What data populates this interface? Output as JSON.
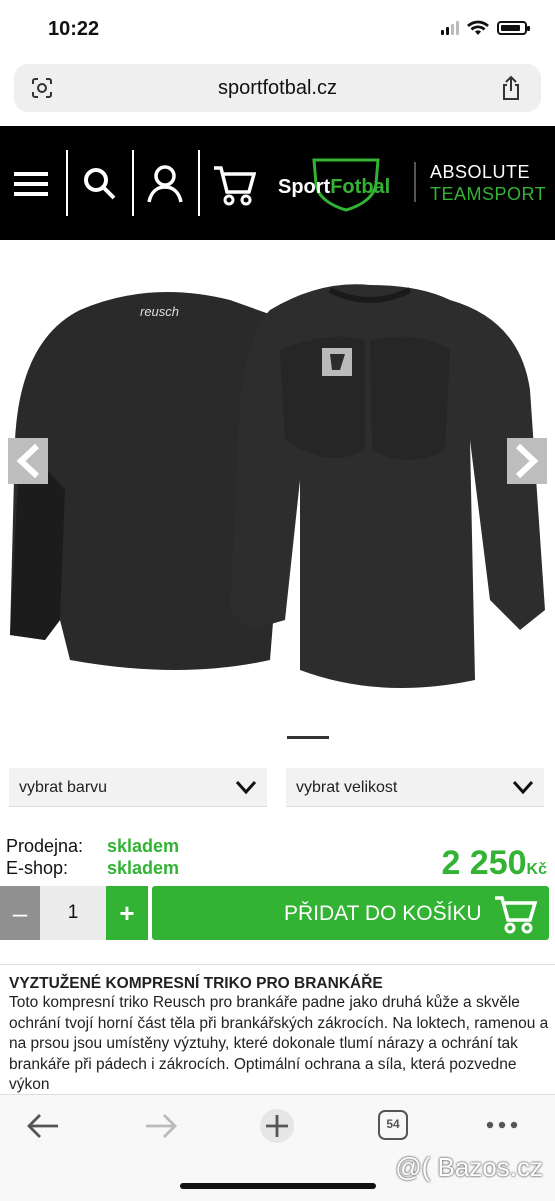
{
  "status": {
    "time": "10:22"
  },
  "browser": {
    "url": "sportfotbal.cz",
    "tabs_count": "54"
  },
  "header": {
    "logo_sport": "Sport",
    "logo_fotbal": "Fotbal",
    "partner_line1": "ABSOLUTE",
    "partner_line2": "TEAMSPORT",
    "icons": [
      "menu-icon",
      "search-icon",
      "user-icon",
      "cart-icon"
    ]
  },
  "gallery": {
    "brand_text": "reusch",
    "prev": "prev-arrow-icon",
    "next": "next-arrow-icon"
  },
  "options": {
    "color_label": "vybrat barvu",
    "size_label": "vybrat velikost"
  },
  "availability": [
    {
      "label": "Prodejna:",
      "value": "skladem"
    },
    {
      "label": "E-shop:",
      "value": "skladem"
    }
  ],
  "price": {
    "amount": "2 250",
    "currency": "Kč"
  },
  "cart": {
    "minus": "–",
    "quantity": "1",
    "plus": "+",
    "add_label": "PŘIDAT DO KOŠÍKU"
  },
  "description": {
    "title": "VYZTUŽENÉ KOMPRESNÍ TRIKO PRO BRANKÁŘE",
    "body": "Toto kompresní triko Reusch pro brankáře padne jako druhá kůže a skvěle ochrání tvojí horní část těla při brankářských zákrocích. Na loktech, ramenou a na prsou jsou umístěny výztuhy, které dokonale tlumí nárazy a ochrání tak brankáře při pádech i zákrocích. Optimální ochrana a síla, která pozvedne výkon"
  },
  "watermark": "@( Bazos.cz",
  "colors": {
    "brand_green": "#32b334",
    "header_bg": "#000000"
  }
}
